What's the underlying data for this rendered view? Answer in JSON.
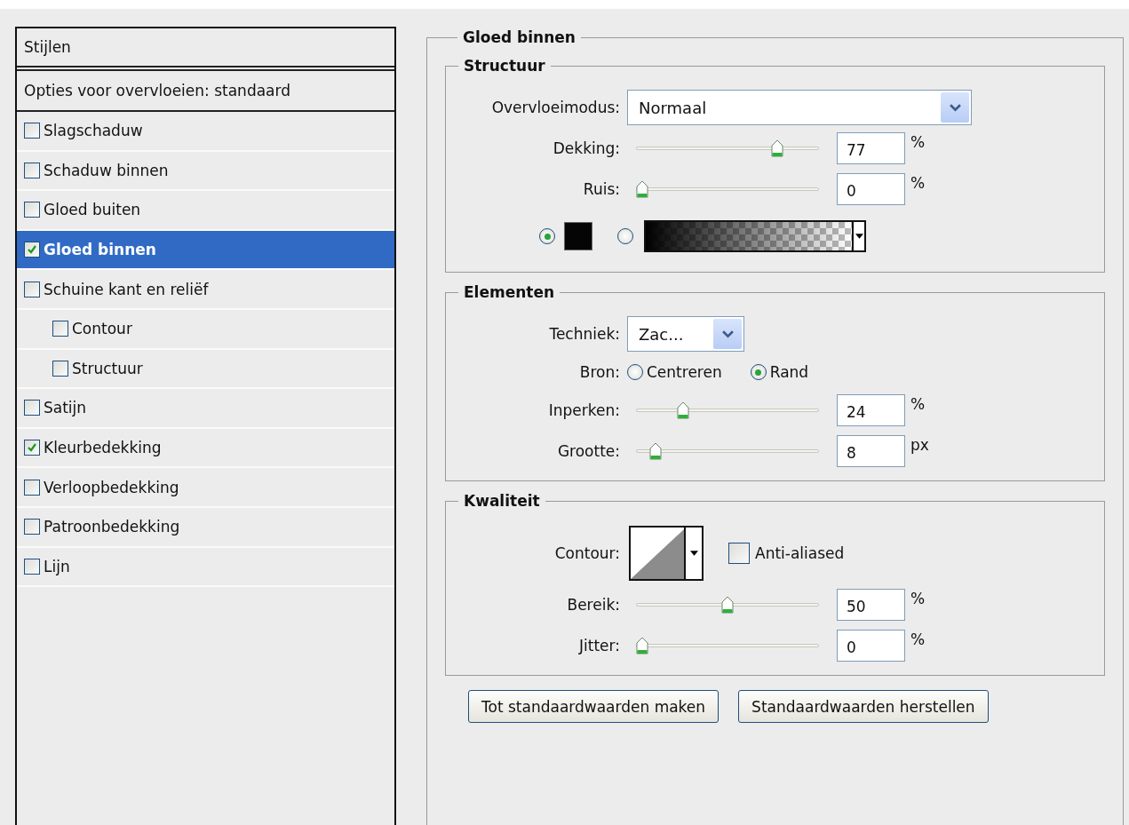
{
  "styles_panel": {
    "header": "Stijlen",
    "blending_options": "Opties voor overvloeien: standaard",
    "items": [
      {
        "label": "Slagschaduw",
        "checked": false,
        "selected": false
      },
      {
        "label": "Schaduw binnen",
        "checked": false,
        "selected": false
      },
      {
        "label": "Gloed buiten",
        "checked": false,
        "selected": false
      },
      {
        "label": "Gloed binnen",
        "checked": true,
        "selected": true
      },
      {
        "label": "Schuine kant en reliëf",
        "checked": false,
        "selected": false,
        "children": [
          {
            "label": "Contour",
            "checked": false,
            "selected": false
          },
          {
            "label": "Structuur",
            "checked": false,
            "selected": false
          }
        ]
      },
      {
        "label": "Satijn",
        "checked": false,
        "selected": false
      },
      {
        "label": "Kleurbedekking",
        "checked": true,
        "selected": false
      },
      {
        "label": "Verloopbedekking",
        "checked": false,
        "selected": false
      },
      {
        "label": "Patroonbedekking",
        "checked": false,
        "selected": false
      },
      {
        "label": "Lijn",
        "checked": false,
        "selected": false
      }
    ]
  },
  "inner_glow": {
    "title": "Gloed binnen",
    "structure": {
      "title": "Structuur",
      "blend_mode": {
        "label": "Overvloeimodus:",
        "value": "Normaal"
      },
      "sliders": [
        {
          "label": "Dekking:",
          "level": 0.79,
          "value": "77",
          "unit": "%"
        },
        {
          "label": "Ruis:",
          "level": 0,
          "value": "0",
          "unit": "%"
        }
      ],
      "fill_options": [
        {
          "kind": "color",
          "selected": true
        },
        {
          "kind": "gradient",
          "selected": false
        }
      ]
    },
    "elements": {
      "title": "Elementen",
      "technique": {
        "label": "Techniek:",
        "value": "Zac..."
      },
      "source": {
        "label": "Bron:",
        "options": [
          {
            "label": "Centreren",
            "selected": false
          },
          {
            "label": "Rand",
            "selected": true
          }
        ]
      },
      "sliders": [
        {
          "label": "Inperken:",
          "level": 0.24,
          "value": "24",
          "unit": "%"
        },
        {
          "label": "Grootte:",
          "level": 0.08,
          "value": "8",
          "unit": "px"
        }
      ]
    },
    "quality": {
      "title": "Kwaliteit",
      "contour": {
        "label": "Contour:"
      },
      "anti_aliased": {
        "label": "Anti-aliased",
        "checked": false
      },
      "sliders": [
        {
          "label": "Bereik:",
          "level": 0.5,
          "value": "50",
          "unit": "%"
        },
        {
          "label": "Jitter:",
          "level": 0,
          "value": "0",
          "unit": "%"
        }
      ]
    },
    "buttons": [
      "Tot standaardwaarden maken",
      "Standaardwaarden herstellen"
    ]
  }
}
